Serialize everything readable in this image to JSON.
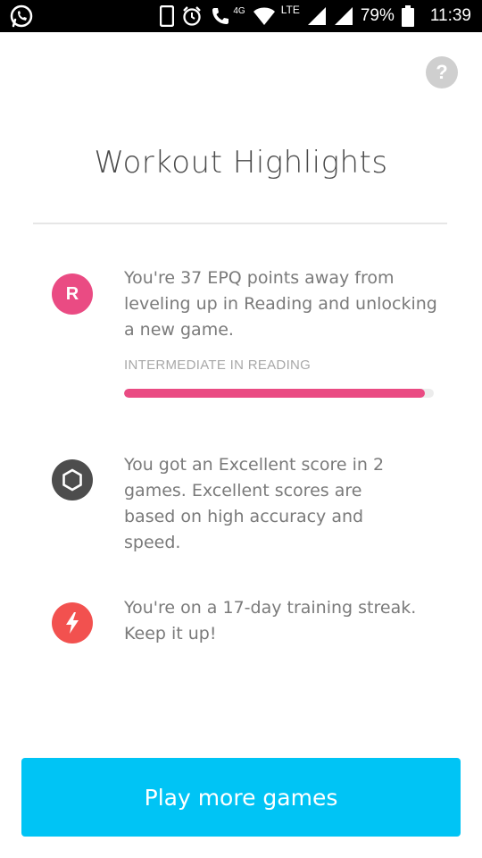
{
  "status_bar": {
    "network_label": "4G",
    "lte_label": "LTE",
    "battery": "79%",
    "time": "11:39",
    "icons": [
      "whatsapp-icon",
      "phone-icon",
      "alarm-icon",
      "call-icon",
      "wifi-icon",
      "signal-icon",
      "signal-icon",
      "battery-icon"
    ]
  },
  "help": {
    "label": "?"
  },
  "header": {
    "title": "Workout Highlights"
  },
  "highlights": [
    {
      "icon": "R",
      "color": "#ea4b83",
      "text": "You're 37 EPQ points away from leveling up in Reading and unlocking a new game.",
      "level_label": "INTERMEDIATE IN READING",
      "progress": 0.97
    },
    {
      "icon": "hexagon-icon",
      "color": "#4d4d4d",
      "text": "You got an Excellent score in 2 games. Excellent scores are based on high accuracy and speed."
    },
    {
      "icon": "lightning-icon",
      "color": "#f2514f",
      "text": "You're on a 17-day training streak. Keep it up!"
    }
  ],
  "cta": {
    "label": "Play more games"
  },
  "colors": {
    "accent": "#00c4f5",
    "reading": "#ea4b83",
    "streak": "#f2514f"
  }
}
